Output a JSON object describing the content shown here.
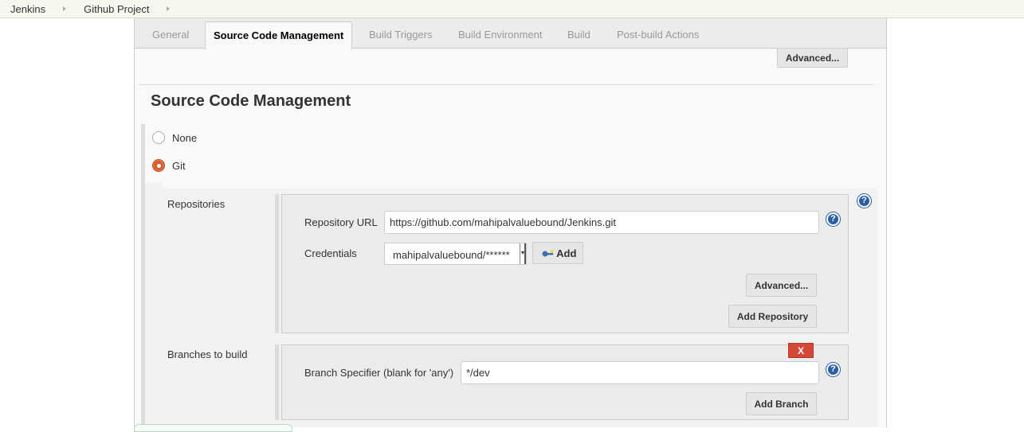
{
  "breadcrumbs": [
    {
      "label": "Jenkins"
    },
    {
      "label": "Github Project"
    }
  ],
  "tabs": [
    {
      "label": "General",
      "active": false
    },
    {
      "label": "Source Code Management",
      "active": true
    },
    {
      "label": "Build Triggers",
      "active": false
    },
    {
      "label": "Build Environment",
      "active": false
    },
    {
      "label": "Build",
      "active": false
    },
    {
      "label": "Post-build Actions",
      "active": false
    }
  ],
  "top_advanced_label": "Advanced...",
  "section": {
    "title": "Source Code Management",
    "options": [
      {
        "label": "None",
        "selected": false
      },
      {
        "label": "Git",
        "selected": true
      }
    ]
  },
  "repositories": {
    "label": "Repositories",
    "url_label": "Repository URL",
    "url_value": "https://github.com/mahipalvaluebound/Jenkins.git",
    "credentials_label": "Credentials",
    "credentials_value": "mahipalvaluebound/******",
    "add_credentials_label": "Add",
    "advanced_label": "Advanced...",
    "add_repository_label": "Add Repository"
  },
  "branches": {
    "label": "Branches to build",
    "specifier_label": "Branch Specifier (blank for 'any')",
    "specifier_value": "*/dev",
    "delete_label": "X",
    "add_branch_label": "Add Branch"
  },
  "icons": {
    "help": "?",
    "breadcrumb_separator": "triangle-right",
    "key": "key-icon"
  },
  "colors": {
    "radio_selected": "#d85d2f",
    "help_icon": "#2a5fa5",
    "delete_button": "#d24939",
    "breadcrumb_bg": "#f6f7ef"
  }
}
